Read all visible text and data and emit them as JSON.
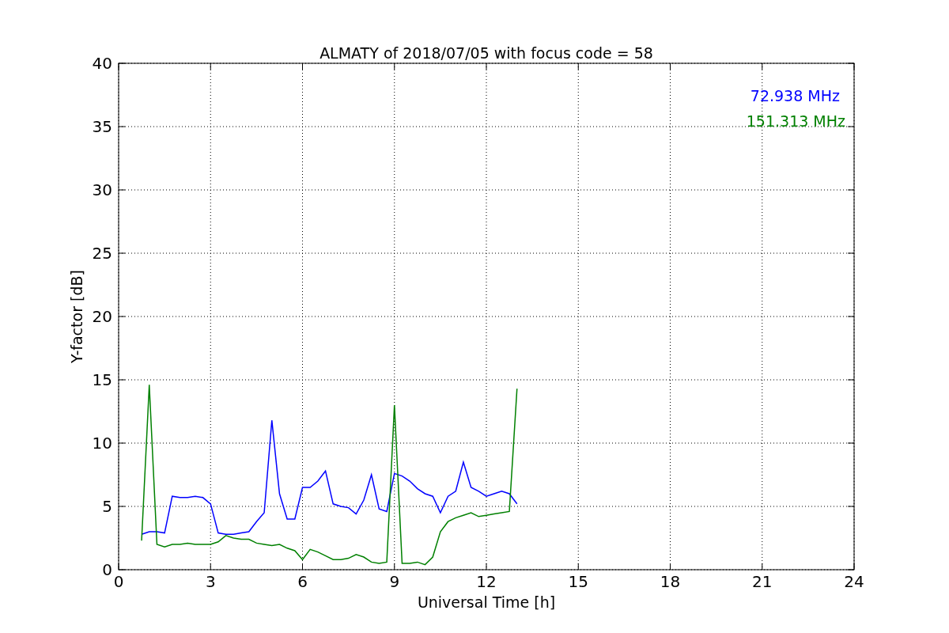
{
  "chart_data": {
    "type": "line",
    "title": "ALMATY of 2018/07/05 with focus code = 58",
    "xlabel": "Universal Time [h]",
    "ylabel": "Y-factor [dB]",
    "x": [
      0.75,
      1.0,
      1.25,
      1.5,
      1.75,
      2.0,
      2.25,
      2.5,
      2.75,
      3.0,
      3.25,
      3.5,
      3.75,
      4.0,
      4.25,
      4.5,
      4.75,
      5.0,
      5.25,
      5.5,
      5.75,
      6.0,
      6.25,
      6.5,
      6.75,
      7.0,
      7.25,
      7.5,
      7.75,
      8.0,
      8.25,
      8.5,
      8.75,
      9.0,
      9.25,
      9.5,
      9.75,
      10.0,
      10.25,
      10.5,
      10.75,
      11.0,
      11.25,
      11.5,
      11.75,
      12.0,
      12.25,
      12.5,
      12.75,
      13.0
    ],
    "series": [
      {
        "name": "72.938 MHz",
        "color": "#0000ff",
        "values": [
          2.8,
          3.0,
          3.0,
          2.9,
          5.8,
          5.7,
          5.7,
          5.8,
          5.7,
          5.2,
          2.9,
          2.8,
          2.8,
          2.9,
          3.0,
          3.8,
          4.5,
          11.8,
          6.0,
          4.0,
          4.0,
          6.5,
          6.5,
          7.0,
          7.8,
          5.2,
          5.0,
          4.9,
          4.4,
          5.5,
          7.5,
          4.8,
          4.6,
          7.6,
          7.4,
          7.0,
          6.4,
          6.0,
          5.8,
          4.5,
          5.8,
          6.2,
          8.5,
          6.5,
          6.2,
          5.8,
          6.0,
          6.2,
          6.0,
          5.2
        ]
      },
      {
        "name": "151.313 MHz",
        "color": "#008000",
        "values": [
          2.3,
          14.6,
          2.0,
          1.8,
          2.0,
          2.0,
          2.1,
          2.0,
          2.0,
          2.0,
          2.2,
          2.7,
          2.5,
          2.4,
          2.4,
          2.1,
          2.0,
          1.9,
          2.0,
          1.7,
          1.5,
          0.8,
          1.6,
          1.4,
          1.1,
          0.8,
          0.8,
          0.9,
          1.2,
          1.0,
          0.6,
          0.5,
          0.6,
          13.0,
          0.5,
          0.5,
          0.6,
          0.4,
          1.0,
          3.0,
          3.8,
          4.1,
          4.3,
          4.5,
          4.2,
          4.3,
          4.4,
          4.5,
          4.6,
          14.3
        ]
      }
    ],
    "grid": true,
    "xlim": [
      0,
      24
    ],
    "ylim": [
      0,
      40
    ],
    "xticks": [
      0,
      3,
      6,
      9,
      12,
      15,
      18,
      21,
      24
    ],
    "yticks": [
      0,
      5,
      10,
      15,
      20,
      25,
      30,
      35,
      40
    ]
  }
}
